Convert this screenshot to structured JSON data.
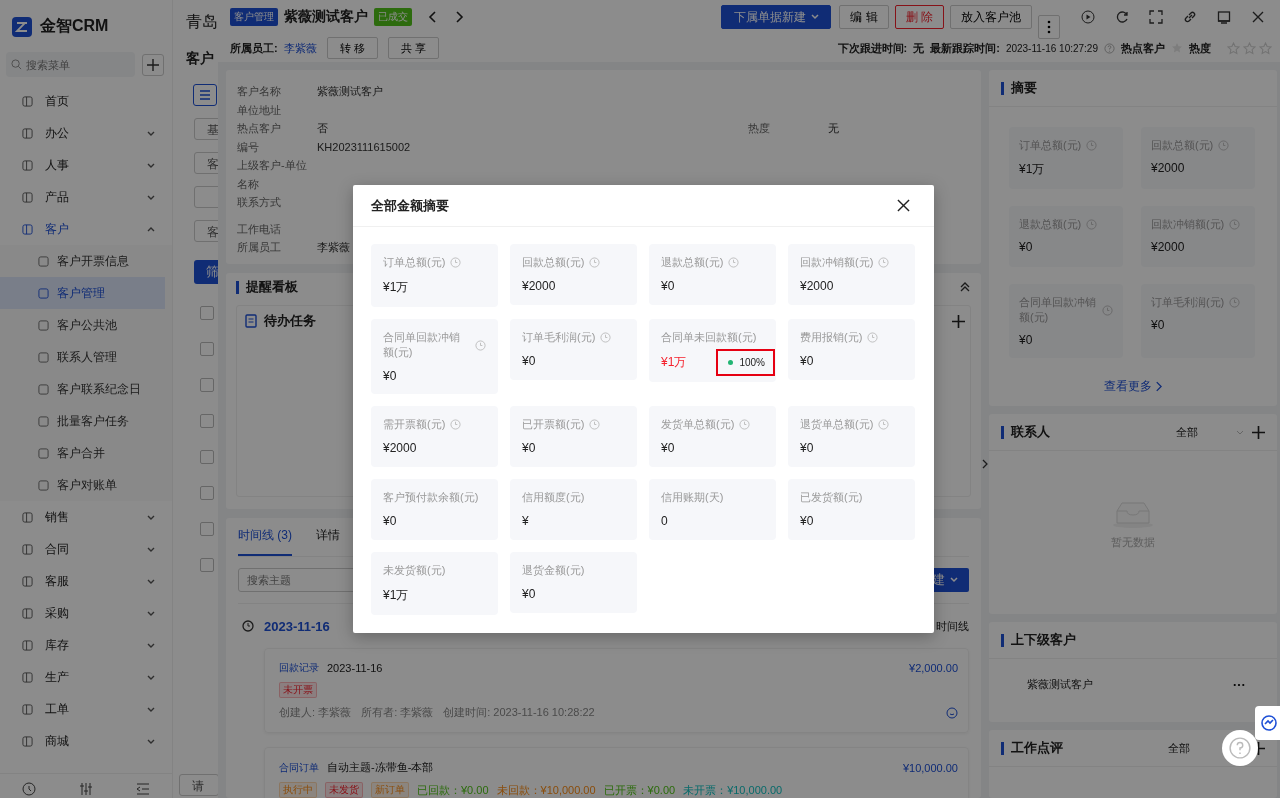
{
  "sidebar": {
    "brand": "金智CRM",
    "search_placeholder": "搜索菜单",
    "items": [
      {
        "label": "首页",
        "kind": "link",
        "selected": false
      },
      {
        "label": "办公",
        "kind": "group",
        "expanded": false,
        "selected": false
      },
      {
        "label": "人事",
        "kind": "group",
        "expanded": false,
        "selected": false
      },
      {
        "label": "产品",
        "kind": "group",
        "expanded": false,
        "selected": false
      },
      {
        "label": "客户",
        "kind": "group",
        "expanded": true,
        "selected": false,
        "children": [
          {
            "label": "客户开票信息",
            "selected": false
          },
          {
            "label": "客户管理",
            "selected": true
          },
          {
            "label": "客户公共池",
            "selected": false
          },
          {
            "label": "联系人管理",
            "selected": false
          },
          {
            "label": "客户联系纪念日",
            "selected": false
          },
          {
            "label": "批量客户任务",
            "selected": false
          },
          {
            "label": "客户合并",
            "selected": false
          },
          {
            "label": "客户对账单",
            "selected": false
          }
        ]
      },
      {
        "label": "销售",
        "kind": "group",
        "expanded": false,
        "selected": false
      },
      {
        "label": "合同",
        "kind": "group",
        "expanded": false,
        "selected": false
      },
      {
        "label": "客服",
        "kind": "group",
        "expanded": false,
        "selected": false
      },
      {
        "label": "采购",
        "kind": "group",
        "expanded": false,
        "selected": false
      },
      {
        "label": "库存",
        "kind": "group",
        "expanded": false,
        "selected": false
      },
      {
        "label": "生产",
        "kind": "group",
        "expanded": false,
        "selected": false
      },
      {
        "label": "工单",
        "kind": "group",
        "expanded": false,
        "selected": false
      },
      {
        "label": "商城",
        "kind": "group",
        "expanded": false,
        "selected": false
      }
    ]
  },
  "background_page": {
    "title": "青岛",
    "subtitle": "客户",
    "fields": [
      "基",
      "客",
      "客"
    ],
    "filter_button": "筛",
    "row_checkboxes": [
      {
        "checked": false
      },
      {
        "checked": false
      },
      {
        "checked": false
      },
      {
        "checked": false
      },
      {
        "checked": false
      },
      {
        "checked": false
      },
      {
        "checked": false
      },
      {
        "checked": false
      }
    ],
    "bottom_field": "请"
  },
  "header": {
    "module_tag": "客户管理",
    "title": "紫薇测试客户",
    "status": "已成交",
    "actions": [
      {
        "label": "下属单据新建",
        "kind": "primary"
      },
      {
        "label": "编 辑",
        "kind": "default"
      },
      {
        "label": "删 除",
        "kind": "danger"
      },
      {
        "label": "放入客户池",
        "kind": "default"
      }
    ],
    "owner_label": "所属员工:",
    "owner": "李紫薇",
    "owner_buttons": [
      "转 移",
      "共 享"
    ],
    "next_follow_label": "下次跟进时间:",
    "next_follow": "无",
    "latest_follow_label": "最新跟踪时间:",
    "latest_follow": "2023-11-16 10:27:29",
    "hot": {
      "label": "热点客户",
      "on": false
    },
    "heat": {
      "label": "热度",
      "stars": 0
    }
  },
  "info": {
    "fields": [
      {
        "label": "客户名称",
        "value": "紫薇测试客户"
      },
      {
        "label": "单位地址"
      },
      {
        "label": "热点客户",
        "value": "否",
        "extra_label": "热度",
        "extra_value": "无"
      },
      {
        "label": "编号",
        "value": "KH2023111615002"
      },
      {
        "label": "上级客户-单位名称"
      },
      {
        "label": "联系方式"
      },
      {
        "label": "工作电话"
      },
      {
        "label": "所属员工",
        "value": "李紫薇"
      }
    ]
  },
  "reminders": {
    "title": "提醒看板",
    "section": "待办任务"
  },
  "activity": {
    "tabs": [
      {
        "label": "时间线 (3)",
        "selected": true
      },
      {
        "label": "详情",
        "selected": false
      }
    ],
    "search_placeholder": "搜索主题",
    "new_button": "建",
    "date": "2023-11-16",
    "view_toggle": "时间线",
    "items": [
      {
        "type": "回款记录",
        "title": "2023-11-16",
        "amount": "¥2,000.00",
        "tags": [
          {
            "text": "未开票",
            "kind": "danger"
          }
        ],
        "meta": [
          "创建人: 李紫薇",
          "所有者: 李紫薇",
          "创建时间: 2023-11-16 10:28:22"
        ]
      },
      {
        "type": "合同订单",
        "title": "自动主题-冻带鱼-本部",
        "amount": "¥10,000.00",
        "tags": [
          {
            "text": "执行中",
            "kind": "warning"
          },
          {
            "text": "未发货",
            "kind": "danger"
          },
          {
            "text": "新订单",
            "kind": "warning"
          }
        ],
        "stats": [
          {
            "text": "已回款：¥0.00",
            "kind": "success"
          },
          {
            "text": "未回款：¥10,000.00",
            "kind": "warning"
          },
          {
            "text": "已开票：¥0.00",
            "kind": "success"
          },
          {
            "text": "未开票：¥10,000.00",
            "kind": "info"
          }
        ]
      }
    ]
  },
  "summary": {
    "title": "摘要",
    "tiles": [
      {
        "label": "订单总额(元)",
        "value": "¥1万"
      },
      {
        "label": "回款总额(元)",
        "value": "¥2000"
      },
      {
        "label": "退款总额(元)",
        "value": "¥0"
      },
      {
        "label": "回款冲销额(元)",
        "value": "¥2000"
      },
      {
        "label": "合同单回款冲销额(元)",
        "value": "¥0"
      },
      {
        "label": "订单毛利润(元)",
        "value": "¥0"
      }
    ],
    "more": "查看更多"
  },
  "contacts": {
    "title": "联系人",
    "filter": "全部",
    "empty": "暂无数据"
  },
  "related": {
    "title": "上下级客户",
    "items": [
      "紫薇测试客户"
    ]
  },
  "reviews": {
    "title": "工作点评",
    "filter": "全部"
  },
  "modal": {
    "title": "全部金额摘要",
    "tiles": [
      {
        "label": "订单总额(元)",
        "value": "¥1万",
        "clock": true,
        "alert": false
      },
      {
        "label": "回款总额(元)",
        "value": "¥2000",
        "clock": true,
        "alert": false
      },
      {
        "label": "退款总额(元)",
        "value": "¥0",
        "clock": true,
        "alert": false
      },
      {
        "label": "回款冲销额(元)",
        "value": "¥2000",
        "clock": true,
        "alert": false
      },
      {
        "label": "合同单回款冲销额(元)",
        "value": "¥0",
        "clock": true,
        "alert": false
      },
      {
        "label": "订单毛利润(元)",
        "value": "¥0",
        "clock": true,
        "alert": false
      },
      {
        "label": "合同单未回款额(元)",
        "value": "¥1万",
        "clock": false,
        "alert": true,
        "badge": {
          "text": "100%",
          "color": "#22b573",
          "highlighted": true
        }
      },
      {
        "label": "费用报销(元)",
        "value": "¥0",
        "clock": true,
        "alert": false
      },
      {
        "label": "需开票额(元)",
        "value": "¥2000",
        "clock": true,
        "alert": false
      },
      {
        "label": "已开票额(元)",
        "value": "¥0",
        "clock": true,
        "alert": false
      },
      {
        "label": "发货单总额(元)",
        "value": "¥0",
        "clock": true,
        "alert": false
      },
      {
        "label": "退货单总额(元)",
        "value": "¥0",
        "clock": true,
        "alert": false
      },
      {
        "label": "客户预付款余额(元)",
        "value": "¥0",
        "clock": false,
        "alert": false
      },
      {
        "label": "信用额度(元)",
        "value": "¥",
        "clock": false,
        "alert": false
      },
      {
        "label": "信用账期(天)",
        "value": "0",
        "clock": false,
        "alert": false
      },
      {
        "label": "已发货额(元)",
        "value": "¥0",
        "clock": false,
        "alert": false
      },
      {
        "label": "未发货额(元)",
        "value": "¥1万",
        "clock": false,
        "alert": false
      },
      {
        "label": "退货金额(元)",
        "value": "¥0",
        "clock": false,
        "alert": false
      }
    ]
  }
}
